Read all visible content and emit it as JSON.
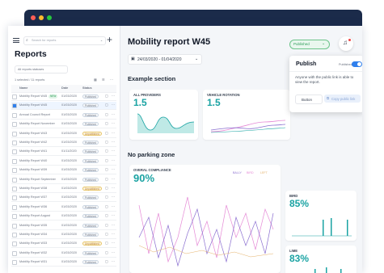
{
  "colors": {
    "accent": "#1aa3a3",
    "pink": "#e58ad6",
    "purple": "#8b6fd0",
    "toggle": "#2f80ed",
    "published": "#2f9e5a"
  },
  "sidebar": {
    "search_placeholder": "Search for reports",
    "title": "Reports",
    "filter": "All reports statuses",
    "selected_count": "1 selected / 11 reports",
    "columns": [
      "Name",
      "Date",
      "Status"
    ],
    "rows": [
      {
        "name": "Mobility Report W45",
        "badge": "NEW",
        "date": "01/03/2020",
        "status": "Published"
      },
      {
        "name": "Mobility Report W45",
        "badge": "",
        "date": "01/03/2020",
        "status": "Published"
      },
      {
        "name": "Annual Council Report",
        "badge": "",
        "date": "01/03/2020",
        "status": "Published"
      },
      {
        "name": "Mobility Report November",
        "badge": "",
        "date": "01/03/2020",
        "status": "Published"
      },
      {
        "name": "Mobility Report W43",
        "badge": "",
        "date": "01/03/2020",
        "status": "Unpublished"
      },
      {
        "name": "Mobility Report W42",
        "badge": "",
        "date": "01/03/2020",
        "status": "Published"
      },
      {
        "name": "Mobility Report W41",
        "badge": "",
        "date": "01/11/2020",
        "status": "Published"
      },
      {
        "name": "Mobility Report W40",
        "badge": "",
        "date": "01/03/2020",
        "status": "Published"
      },
      {
        "name": "Mobility Report W39",
        "badge": "",
        "date": "01/03/2020",
        "status": "Published"
      },
      {
        "name": "Mobility Report September",
        "badge": "",
        "date": "01/03/2020",
        "status": "Published"
      },
      {
        "name": "Mobility Report W38",
        "badge": "",
        "date": "01/03/2020",
        "status": "Unpublished"
      },
      {
        "name": "Mobility Report W37",
        "badge": "",
        "date": "01/03/2020",
        "status": "Published"
      },
      {
        "name": "Mobility Report W36",
        "badge": "",
        "date": "01/03/2020",
        "status": "Published"
      },
      {
        "name": "Mobility Report August",
        "badge": "",
        "date": "01/03/2020",
        "status": "Published"
      },
      {
        "name": "Mobility Report W35",
        "badge": "",
        "date": "01/03/2020",
        "status": "Published"
      },
      {
        "name": "Mobility Report W34",
        "badge": "",
        "date": "01/03/2020",
        "status": "Published"
      },
      {
        "name": "Mobility Report W33",
        "badge": "",
        "date": "01/03/2020",
        "status": "Unpublished"
      },
      {
        "name": "Mobility Report W32",
        "badge": "",
        "date": "01/03/2020",
        "status": "Published"
      },
      {
        "name": "Mobility Report W31",
        "badge": "",
        "date": "01/03/2020",
        "status": "Published"
      }
    ]
  },
  "main": {
    "title": "Mobility report W45",
    "status_button": "Published",
    "date_range": "24/03/2020 - 01/04/2020",
    "section1": "Example section",
    "section2": "No parking zone",
    "cards": {
      "all_providers": {
        "title": "ALL PROVIDERS",
        "value": "1.5"
      },
      "vehicle_rotation": {
        "title": "VEHICLE ROTATION",
        "value": "1.5"
      },
      "overall_compliance": {
        "title": "OVERAL COMPLIANCE",
        "value": "90%",
        "legend": [
          "BALLY",
          "BIRD",
          "LEFT"
        ]
      },
      "bird": {
        "title": "BIRD",
        "value": "85%"
      },
      "lime": {
        "title": "LIME",
        "value": "83%"
      }
    }
  },
  "popover": {
    "title": "Publish",
    "toggle_label": "Published",
    "description": "Anyone with the public link is able to view the report.",
    "button": "Button",
    "copy_link": "Copy public link"
  }
}
